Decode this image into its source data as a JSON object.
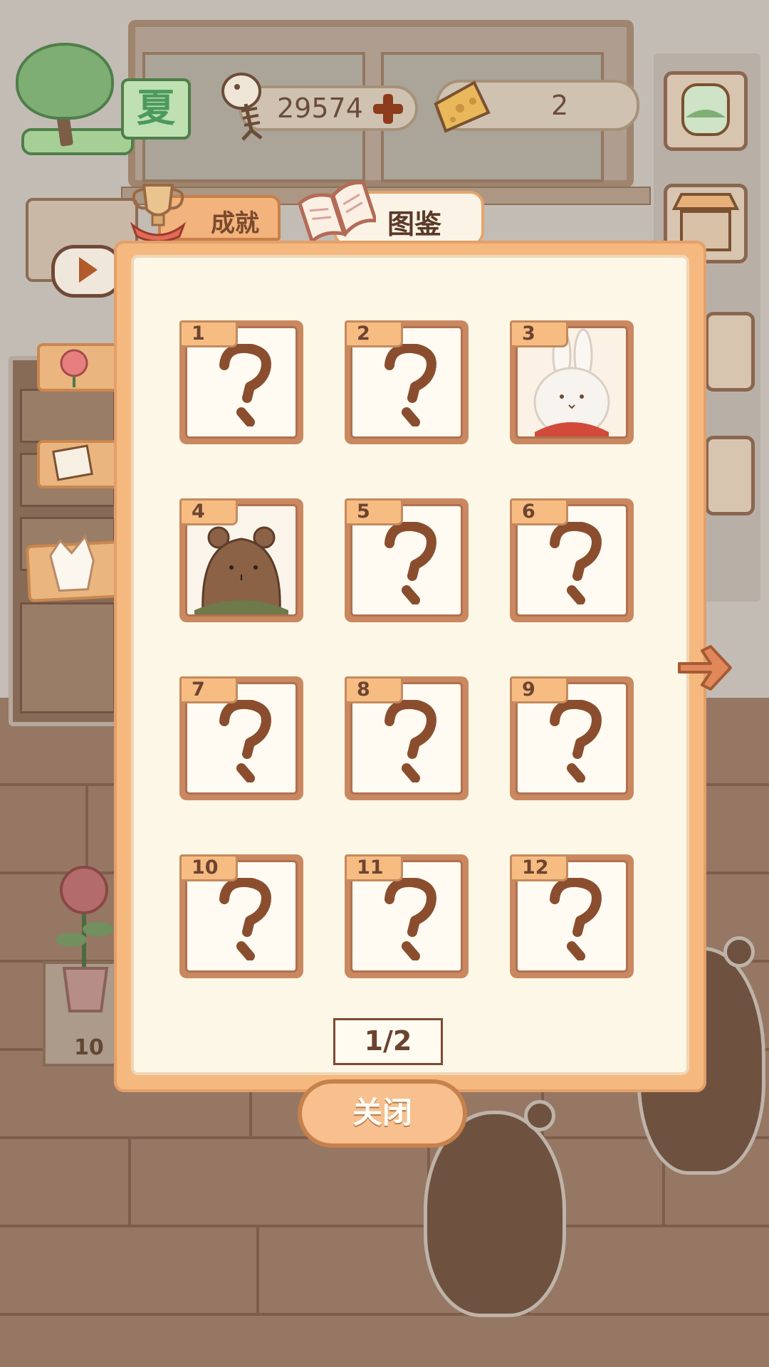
{
  "hud": {
    "season": "夏",
    "fish_count": "29574",
    "cheese_count": "2"
  },
  "tabs": {
    "achievements": "成就",
    "collection": "图鉴"
  },
  "collection": {
    "cards": [
      {
        "number": "1",
        "state": "locked"
      },
      {
        "number": "2",
        "state": "locked"
      },
      {
        "number": "3",
        "state": "unlocked",
        "portrait": "rabbit"
      },
      {
        "number": "4",
        "state": "unlocked",
        "portrait": "bear"
      },
      {
        "number": "5",
        "state": "locked"
      },
      {
        "number": "6",
        "state": "locked"
      },
      {
        "number": "7",
        "state": "locked"
      },
      {
        "number": "8",
        "state": "locked"
      },
      {
        "number": "9",
        "state": "locked"
      },
      {
        "number": "10",
        "state": "locked"
      },
      {
        "number": "11",
        "state": "locked"
      },
      {
        "number": "12",
        "state": "locked"
      }
    ],
    "page": "1/2",
    "close_label": "关闭"
  },
  "background": {
    "table_number": "10"
  },
  "icons": {
    "fish": "fish-bone-icon",
    "add": "plus-icon",
    "cheese": "cheese-icon",
    "trophy": "trophy-icon",
    "book": "book-icon",
    "next": "arrow-right-icon"
  },
  "colors": {
    "panel": "#f5b87e",
    "panel_inner": "#fdf7e7",
    "card_border": "#c98860",
    "question_mark": "#8a4e2f",
    "close_text": "#fffdf7"
  }
}
